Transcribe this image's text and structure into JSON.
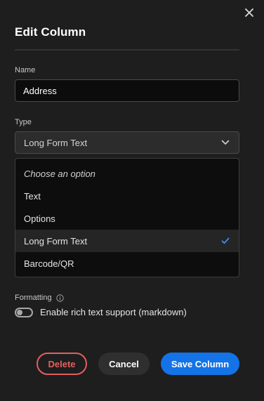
{
  "dialog": {
    "title": "Edit Column"
  },
  "name_field": {
    "label": "Name",
    "value": "Address"
  },
  "type_field": {
    "label": "Type",
    "selected": "Long Form Text",
    "options": [
      {
        "label": "Choose an option",
        "placeholder": true
      },
      {
        "label": "Text"
      },
      {
        "label": "Options"
      },
      {
        "label": "Long Form Text",
        "selected": true
      },
      {
        "label": "Barcode/QR"
      }
    ]
  },
  "formatting": {
    "label": "Formatting",
    "toggle_label": "Enable rich text support (markdown)",
    "enabled": false
  },
  "buttons": {
    "delete": "Delete",
    "cancel": "Cancel",
    "save": "Save Column"
  },
  "colors": {
    "accent": "#1473e6",
    "danger": "#e26060",
    "background": "#1e1e1e"
  }
}
